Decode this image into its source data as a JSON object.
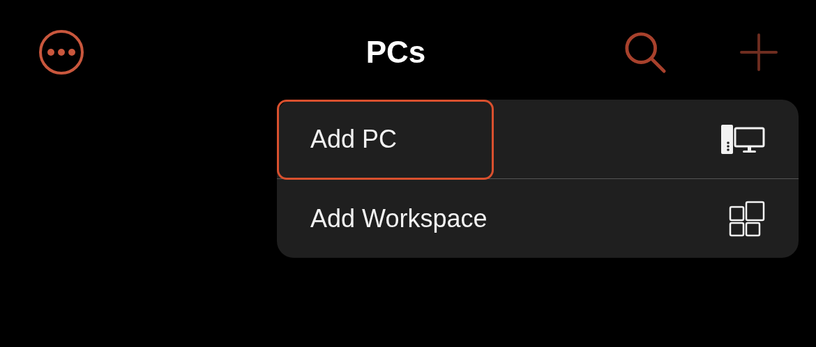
{
  "header": {
    "title": "PCs"
  },
  "menu": {
    "items": [
      {
        "label": "Add PC",
        "kind": "pc",
        "highlighted": true
      },
      {
        "label": "Add Workspace",
        "kind": "workspace",
        "highlighted": false
      }
    ]
  }
}
